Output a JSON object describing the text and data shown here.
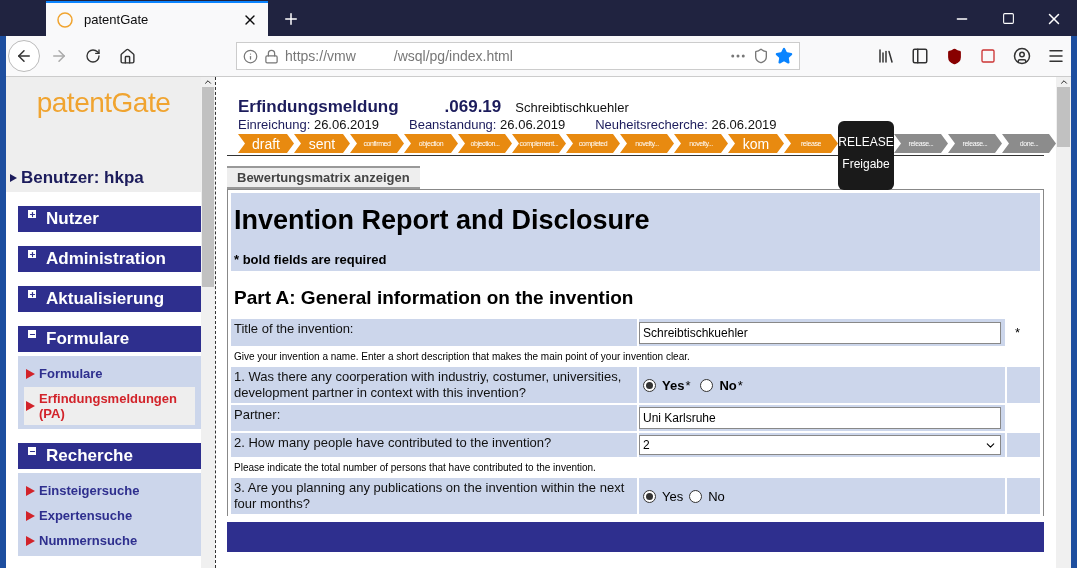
{
  "browser": {
    "tab_title": "patentGate",
    "url_host": "https://vmw",
    "url_path": "/wsql/pg/index.html",
    "bookmarked": true
  },
  "sidebar": {
    "logo": "patentGate",
    "user": "Benutzer: hkpa",
    "sections": [
      {
        "title": "Nutzer",
        "expanded": false
      },
      {
        "title": "Administration",
        "expanded": false
      },
      {
        "title": "Aktualisierung",
        "expanded": false
      },
      {
        "title": "Formulare",
        "expanded": true,
        "items": [
          {
            "label": "Formulare",
            "selected": false
          },
          {
            "label": "Erfindungsmeldungen (PA)",
            "selected": true
          }
        ]
      },
      {
        "title": "Recherche",
        "expanded": true,
        "items": [
          {
            "label": "Einsteigersuche",
            "selected": false
          },
          {
            "label": "Expertensuche",
            "selected": false
          },
          {
            "label": "Nummernsuche",
            "selected": false
          }
        ]
      }
    ]
  },
  "header": {
    "title": "Erfindungsmeldung",
    "number": ".069.19",
    "subject": "Schreibtischkuehler",
    "dates": [
      {
        "label": "Einreichung:",
        "value": "26.06.2019"
      },
      {
        "label": "Beanstandung:",
        "value": "26.06.2019"
      },
      {
        "label": "Neuheitsrecherche:",
        "value": "26.06.2019"
      }
    ],
    "steps": [
      {
        "label": "draft",
        "done": true,
        "large": true
      },
      {
        "label": "sent",
        "done": true,
        "large": true
      },
      {
        "label": "confirmed",
        "done": true,
        "large": false
      },
      {
        "label": "objection",
        "done": true,
        "large": false
      },
      {
        "label": "objection...",
        "done": true,
        "large": false
      },
      {
        "label": "complement...",
        "done": true,
        "large": false
      },
      {
        "label": "completed",
        "done": true,
        "large": false
      },
      {
        "label": "novelty...",
        "done": true,
        "large": false
      },
      {
        "label": "novelty...",
        "done": true,
        "large": false
      },
      {
        "label": "kom",
        "done": true,
        "large": true
      },
      {
        "label": "release",
        "done": true,
        "large": false
      },
      {
        "label": "release...",
        "done": false,
        "large": false
      },
      {
        "label": "release...",
        "done": false,
        "large": false
      },
      {
        "label": "done...",
        "done": false,
        "large": false
      }
    ],
    "tooltip": {
      "title": "RELEASE",
      "text": "Freigabe"
    }
  },
  "matrix_tab": "Bewertungsmatrix anzeigen",
  "form": {
    "title": "Invention Report and Disclosure",
    "note": "* bold fields are required",
    "part": "Part A: General information on the invention",
    "rows": [
      {
        "kind": "text",
        "label": "Title of the invention:",
        "value": "Schreibtischkuehler",
        "mark": "*"
      },
      {
        "kind": "hint",
        "label": "Give your invention a name. Enter a short description that makes the main point of your invention clear."
      },
      {
        "kind": "radio",
        "label": "1. Was there any coorperation with industriy, costumer, universities, development partner in context with this invention?",
        "bold": true,
        "options": [
          {
            "label": "Yes",
            "mark": "*",
            "selected": true
          },
          {
            "label": "No",
            "mark": "*",
            "selected": false
          }
        ]
      },
      {
        "kind": "text",
        "label": "Partner:",
        "value": "Uni Karlsruhe"
      },
      {
        "kind": "select",
        "label": "2. How many people have contributed to the invention?",
        "value": "2"
      },
      {
        "kind": "hint",
        "label": "Please indicate the total number of persons that have contributed to the invention."
      },
      {
        "kind": "radio",
        "label": "3. Are you planning any publications on the invention within the next four months?",
        "bold": false,
        "options": [
          {
            "label": "Yes",
            "selected": true
          },
          {
            "label": "No",
            "selected": false
          }
        ]
      }
    ]
  }
}
